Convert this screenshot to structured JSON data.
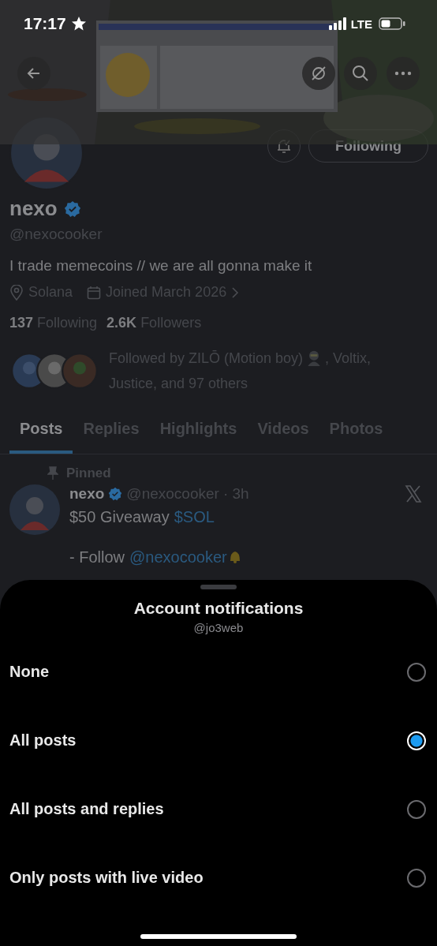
{
  "status_bar": {
    "time": "17:17",
    "network": "LTE"
  },
  "profile": {
    "name": "nexo",
    "verified": true,
    "handle": "@nexocooker",
    "follow_button": "Following",
    "bio": "I trade memecoins // we are all gonna make it",
    "location": "Solana",
    "joined": "Joined March 2026",
    "stats": [
      {
        "count": "137",
        "label": "Following"
      },
      {
        "count": "2.6K",
        "label": "Followers"
      }
    ],
    "followed_by_1": "Followed by ZILŌ (Motion boy)",
    "followed_by_2": ", Voltix,",
    "followed_by_3": "Justice, and 97 others"
  },
  "tabs": [
    {
      "label": "Posts",
      "selected": true
    },
    {
      "label": "Replies",
      "selected": false
    },
    {
      "label": "Highlights",
      "selected": false
    },
    {
      "label": "Videos",
      "selected": false
    },
    {
      "label": "Photos",
      "selected": false
    }
  ],
  "post": {
    "pinned_label": "Pinned",
    "name": "nexo",
    "handle": "@nexocooker",
    "time": "· 3h",
    "text": "$50 Giveaway",
    "cashtag": "$SOL",
    "line2": "- Follow",
    "mention": "@nexocooker"
  },
  "sheet": {
    "title": "Account notifications",
    "subtitle": "@jo3web",
    "options": [
      {
        "label": "None",
        "selected": false
      },
      {
        "label": "All posts",
        "selected": true
      },
      {
        "label": "All posts and replies",
        "selected": false
      },
      {
        "label": "Only posts with live video",
        "selected": false
      }
    ]
  }
}
